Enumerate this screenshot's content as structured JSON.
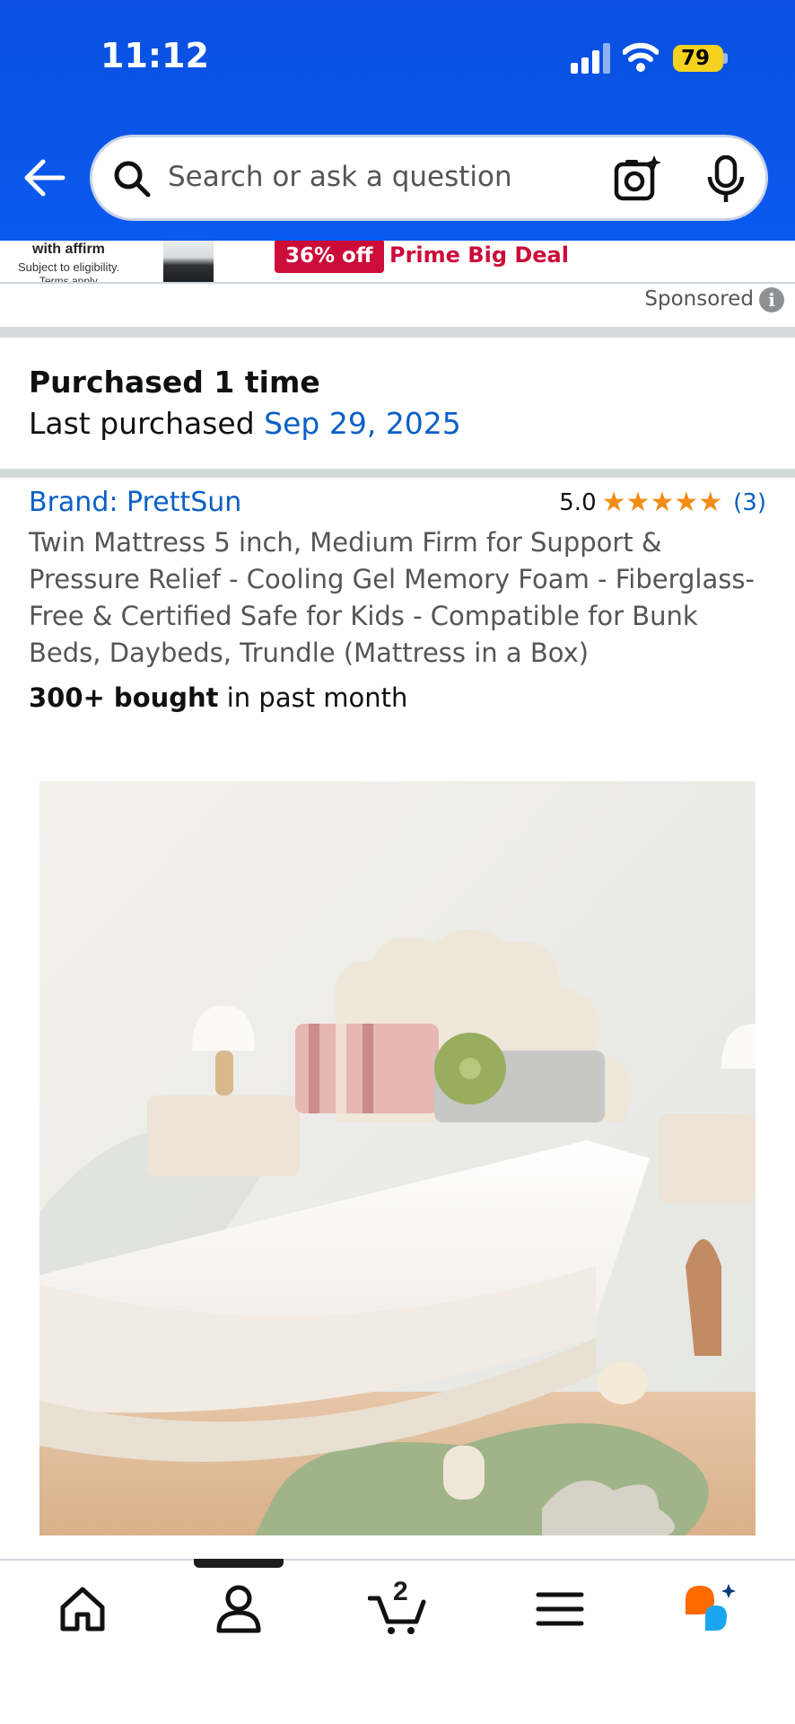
{
  "status_bar": {
    "time": "11:12",
    "battery": "79"
  },
  "search": {
    "placeholder": "Search or ask a question"
  },
  "ad": {
    "affirm_text": "with affirm",
    "eligibility": "Subject to eligibility.",
    "terms": "Terms apply",
    "badge": "36% off",
    "deal_label": "Prime Big Deal",
    "sponsored": "Sponsored"
  },
  "purchase_info": {
    "count_label": "Purchased 1 time",
    "last_label": "Last purchased ",
    "last_date": "Sep 29, 2025"
  },
  "product": {
    "brand": "Brand: PrettSun",
    "rating": "5.0",
    "rating_stars": 5,
    "rating_count": "(3)",
    "title": "Twin Mattress 5 inch, Medium Firm for Support & Pressure Relief - Cooling Gel Memory Foam - Fiberglass-Free & Certified Safe for Kids - Compatible for Bunk Beds, Daybeds, Trundle (Mattress in a Box)",
    "bought_bold": "300+ bought",
    "bought_rest": " in past month"
  },
  "tabbar": {
    "cart_count": "2"
  },
  "colors": {
    "header_blue": "#0b56e8",
    "deal_red": "#cc0c39",
    "link_blue": "#0a5fc8",
    "star_orange": "#f28c16"
  }
}
